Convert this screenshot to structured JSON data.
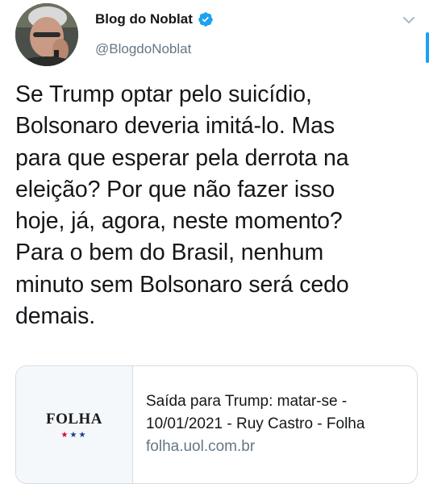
{
  "tweet": {
    "author": {
      "display_name": "Blog do Noblat",
      "handle": "@BlogdoNoblat",
      "verified": true
    },
    "text": "Se Trump optar pelo suicídio,\nBolsonaro deveria imitá-lo. Mas\npara que esperar pela derrota na\neleição? Por que não fazer isso\nhoje, já, agora, neste momento?\nPara o bem do Brasil, nenhum\nminuto sem Bolsonaro será cedo\ndemais.",
    "link_card": {
      "thumbnail_logo": "FOLHA",
      "thumbnail_stars": "★★★",
      "title": "Saída para Trump: matar-se -\n10/01/2021 - Ruy Castro - Folha",
      "domain": "folha.uol.com.br"
    }
  },
  "icons": {
    "verified": "verified-badge-icon",
    "menu": "chevron-down-icon"
  },
  "colors": {
    "verified_blue": "#1da1f2",
    "secondary_text": "#657786",
    "primary_text": "#14171a",
    "card_border": "#d6dde3"
  }
}
